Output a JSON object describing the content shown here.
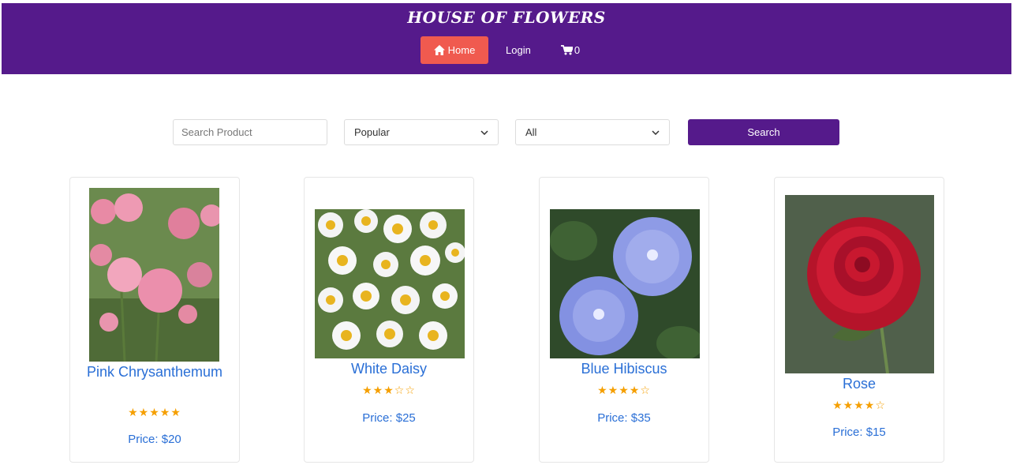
{
  "header": {
    "brand": "HOUSE OF FLOWERS",
    "nav": {
      "home_label": "Home",
      "login_label": "Login",
      "cart_count": "0"
    },
    "colors": {
      "background": "#551a8b",
      "home_active": "#f05a4f"
    }
  },
  "filters": {
    "search_placeholder": "Search Product",
    "sort_selected": "Popular",
    "category_selected": "All",
    "search_button_label": "Search"
  },
  "products": [
    {
      "name": "Pink Chrysanthemum",
      "rating": 5,
      "stars": "★★★★★",
      "price": "Price: $20"
    },
    {
      "name": "White Daisy",
      "rating": 3,
      "stars": "★★★☆☆",
      "price": "Price: $25"
    },
    {
      "name": "Blue Hibiscus",
      "rating": 4,
      "stars": "★★★★☆",
      "price": "Price: $35"
    },
    {
      "name": "Rose",
      "rating": 4,
      "stars": "★★★★☆",
      "price": "Price: $15"
    }
  ]
}
